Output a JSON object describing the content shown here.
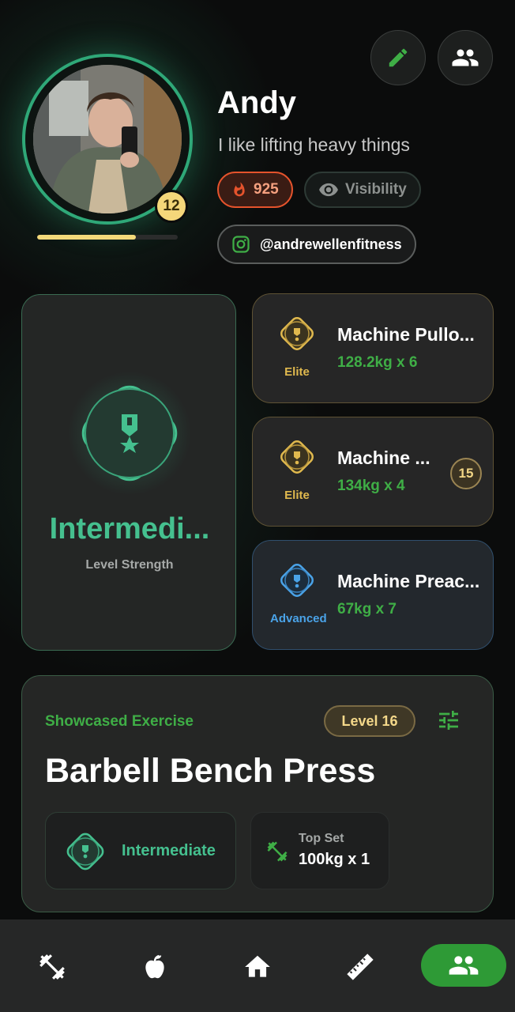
{
  "header": {
    "edit_icon": "pencil-icon",
    "friends_icon": "people-icon"
  },
  "profile": {
    "name": "Andy",
    "bio": "I like lifting heavy things",
    "level": "12",
    "xp_progress": 0.7,
    "streak": "925",
    "visibility_label": "Visibility",
    "instagram_handle": "@andrewellenfitness"
  },
  "strength_card": {
    "tier": "Intermedi...",
    "subtitle": "Level Strength"
  },
  "exercises": [
    {
      "title": "Machine Pullo...",
      "set": "128.2kg x 6",
      "tier": "Elite"
    },
    {
      "title": "Machine ...",
      "set": "134kg x 4",
      "tier": "Elite",
      "badge": "15"
    },
    {
      "title": "Machine Preac...",
      "set": "67kg x 7",
      "tier": "Advanced"
    }
  ],
  "showcase": {
    "label": "Showcased Exercise",
    "level": "Level 16",
    "title": "Barbell Bench Press",
    "tier": "Intermediate",
    "top_set_label": "Top Set",
    "top_set_value": "100kg x 1"
  },
  "nav": {
    "items": [
      "dumbbell-icon",
      "apple-icon",
      "home-icon",
      "ruler-icon",
      "people-icon"
    ],
    "active": "people-icon"
  },
  "colors": {
    "accent_green": "#3fae46",
    "teal": "#45c08f",
    "gold": "#e0b94e",
    "blue": "#4aa3e8",
    "streak_orange": "#e5532c"
  }
}
